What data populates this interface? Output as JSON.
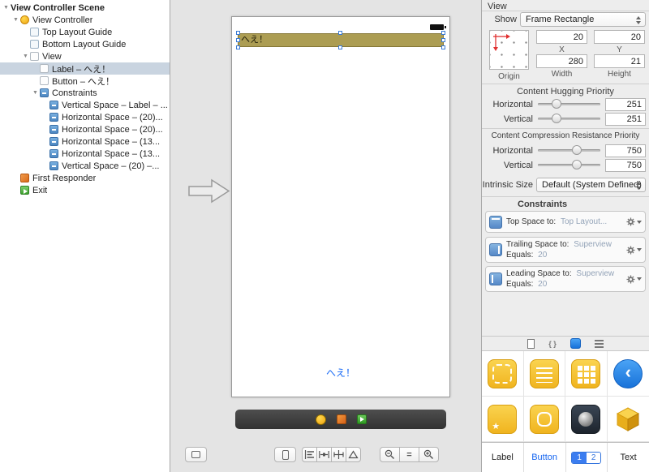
{
  "outline": {
    "scene_title": "View Controller Scene",
    "items": [
      {
        "label": "View Controller"
      },
      {
        "label": "Top Layout Guide"
      },
      {
        "label": "Bottom Layout Guide"
      },
      {
        "label": "View"
      },
      {
        "label": "Label – へえ！"
      },
      {
        "label": "Button – へえ！"
      },
      {
        "label": "Constraints"
      },
      {
        "label": "Vertical Space – Label – ..."
      },
      {
        "label": "Horizontal Space – (20)..."
      },
      {
        "label": "Horizontal Space – (20)..."
      },
      {
        "label": "Horizontal Space – (13..."
      },
      {
        "label": "Horizontal Space – (13..."
      },
      {
        "label": "Vertical Space – (20) –..."
      },
      {
        "label": "First Responder"
      },
      {
        "label": "Exit"
      }
    ]
  },
  "canvas": {
    "label_text": "へえ！",
    "button_text": "へえ！"
  },
  "inspector": {
    "title": "View",
    "show": {
      "label": "Show",
      "value": "Frame Rectangle"
    },
    "frame": {
      "origin_label": "Origin",
      "x_label": "X",
      "x_value": "20",
      "y_label": "Y",
      "y_value": "20",
      "width_label": "Width",
      "width_value": "280",
      "height_label": "Height",
      "height_value": "21"
    },
    "hugging": {
      "title": "Content Hugging Priority",
      "rows": [
        {
          "label": "Horizontal",
          "value": "251"
        },
        {
          "label": "Vertical",
          "value": "251"
        }
      ]
    },
    "compression": {
      "title": "Content Compression Resistance Priority",
      "rows": [
        {
          "label": "Horizontal",
          "value": "750"
        },
        {
          "label": "Vertical",
          "value": "750"
        }
      ]
    },
    "intrinsic": {
      "label": "Intrinsic Size",
      "value": "Default (System Defined)"
    },
    "constraints": {
      "title": "Constraints",
      "rows": [
        {
          "label": "Top Space to:",
          "value": "Top Layout...",
          "label2": "",
          "value2": ""
        },
        {
          "label": "Trailing Space to:",
          "value": "Superview",
          "label2": "Equals:",
          "value2": "20"
        },
        {
          "label": "Leading Space to:",
          "value": "Superview",
          "label2": "Equals:",
          "value2": "20"
        }
      ]
    }
  },
  "library": {
    "item_names": [
      "Label",
      "Button",
      "Text"
    ],
    "segments": [
      "1",
      "2"
    ]
  },
  "colors": {
    "label_background": "#ac9d53",
    "button_text_color": "#1668f5",
    "selection_blue": "#3a7bd5"
  }
}
